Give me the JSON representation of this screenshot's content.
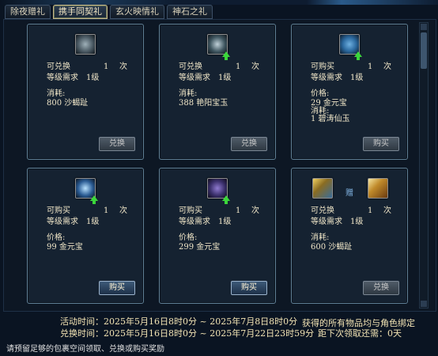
{
  "tabs": [
    "除夜赠礼",
    "携手同契礼",
    "玄火映情礼",
    "神石之礼"
  ],
  "cards": [
    {
      "r1_label": "可兑换",
      "r1_value": "1",
      "r1_unit": "次",
      "r2": "等级需求　1级",
      "cost_label": "消耗:",
      "cost_lines": [
        "800 沙蝎趾"
      ],
      "button": "兑换",
      "button_enabled": false,
      "icon_color": "#4b5a64"
    },
    {
      "r1_label": "可兑换",
      "r1_value": "1",
      "r1_unit": "次",
      "r2": "等级需求　1级",
      "cost_label": "消耗:",
      "cost_lines": [
        "388 艳阳宝玉"
      ],
      "button": "兑换",
      "button_enabled": false,
      "icon_color": "#3f5660"
    },
    {
      "r1_label": "可购买",
      "r1_value": "1",
      "r1_unit": "次",
      "r2": "等级需求　1级",
      "cost_label": "价格:",
      "cost_lines": [
        "29 金元宝",
        "消耗:",
        "1 碧涛仙玉"
      ],
      "button": "购买",
      "button_enabled": false,
      "icon_color": "#2c6aa0"
    },
    {
      "r1_label": "可购买",
      "r1_value": "1",
      "r1_unit": "次",
      "r2": "等级需求　1级",
      "cost_label": "价格:",
      "cost_lines": [
        "99 金元宝"
      ],
      "button": "购买",
      "button_enabled": true,
      "icon_color": "#2a5b93"
    },
    {
      "r1_label": "可购买",
      "r1_value": "1",
      "r1_unit": "次",
      "r2": "等级需求　1级",
      "cost_label": "价格:",
      "cost_lines": [
        "299 金元宝"
      ],
      "button": "购买",
      "button_enabled": true,
      "icon_color": "#3a2f6a"
    },
    {
      "r1_label": "可兑换",
      "r1_value": "1",
      "r1_unit": "次",
      "r2": "等级需求　1级",
      "cost_label": "消耗:",
      "cost_lines": [
        "600 沙蝎趾"
      ],
      "button": "兑换",
      "button_enabled": false,
      "icon_color": "#8a6c22"
    }
  ],
  "gift_word": "赠",
  "footer": {
    "activity_time": "活动时间：2025年5月16日8时0分 ~ 2025年7月8日8时0分",
    "exchange_time": "兑换时间：2025年5月16日8时0分 ~ 2025年7月22日23时59分",
    "bound_note": "获得的所有物品均与角色绑定",
    "next_claim": "距下次领取还需：0天",
    "notice": "请预留足够的包裹空间领取、兑换或购买奖励"
  }
}
